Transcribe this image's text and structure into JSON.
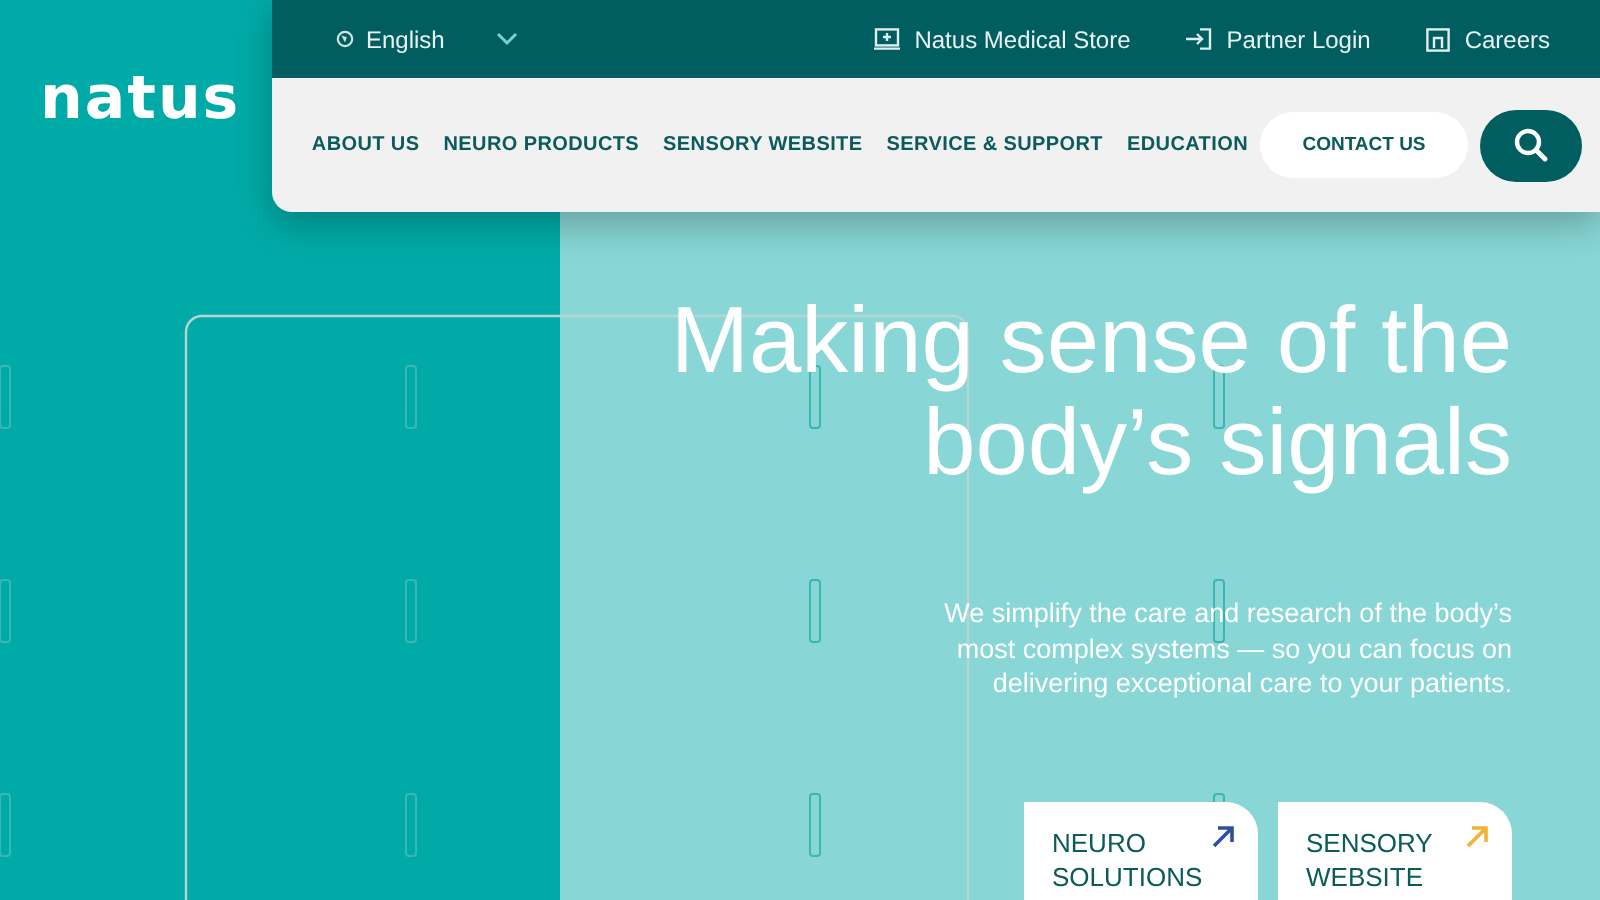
{
  "logo": "natus",
  "language": {
    "label": "English"
  },
  "utility_links": [
    {
      "label": "Natus Medical Store",
      "kind": "store"
    },
    {
      "label": "Partner Login",
      "kind": "login"
    },
    {
      "label": "Careers",
      "kind": "careers"
    }
  ],
  "nav": [
    "ABOUT US",
    "NEURO PRODUCTS",
    "SENSORY WEBSITE",
    "SERVICE & SUPPORT",
    "EDUCATION"
  ],
  "contact_button": "CONTACT US",
  "hero": {
    "headline": "Making sense of the body’s signals",
    "text": "We simplify the care and research of the body’s most complex systems — so you can focus on delivering exceptional care to your patients."
  },
  "cards": [
    {
      "label": "NEURO SOLUTIONS",
      "color": "#2e4f9c"
    },
    {
      "label": "SENSORY WEBSITE",
      "color": "#f2b233"
    }
  ]
}
